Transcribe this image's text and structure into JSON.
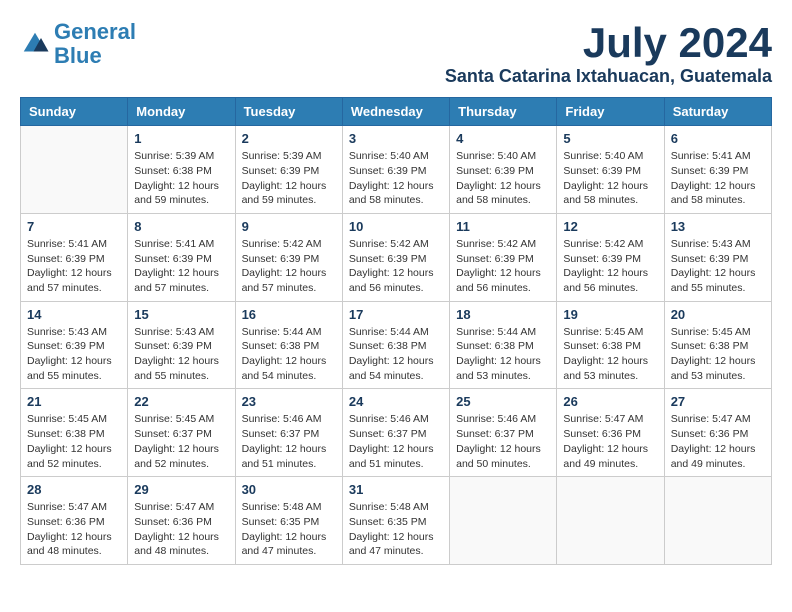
{
  "header": {
    "logo_line1": "General",
    "logo_line2": "Blue",
    "month_year": "July 2024",
    "location": "Santa Catarina Ixtahuacan, Guatemala"
  },
  "weekdays": [
    "Sunday",
    "Monday",
    "Tuesday",
    "Wednesday",
    "Thursday",
    "Friday",
    "Saturday"
  ],
  "weeks": [
    [
      {
        "day": "",
        "content": ""
      },
      {
        "day": "1",
        "content": "Sunrise: 5:39 AM\nSunset: 6:38 PM\nDaylight: 12 hours\nand 59 minutes."
      },
      {
        "day": "2",
        "content": "Sunrise: 5:39 AM\nSunset: 6:39 PM\nDaylight: 12 hours\nand 59 minutes."
      },
      {
        "day": "3",
        "content": "Sunrise: 5:40 AM\nSunset: 6:39 PM\nDaylight: 12 hours\nand 58 minutes."
      },
      {
        "day": "4",
        "content": "Sunrise: 5:40 AM\nSunset: 6:39 PM\nDaylight: 12 hours\nand 58 minutes."
      },
      {
        "day": "5",
        "content": "Sunrise: 5:40 AM\nSunset: 6:39 PM\nDaylight: 12 hours\nand 58 minutes."
      },
      {
        "day": "6",
        "content": "Sunrise: 5:41 AM\nSunset: 6:39 PM\nDaylight: 12 hours\nand 58 minutes."
      }
    ],
    [
      {
        "day": "7",
        "content": "Sunrise: 5:41 AM\nSunset: 6:39 PM\nDaylight: 12 hours\nand 57 minutes."
      },
      {
        "day": "8",
        "content": "Sunrise: 5:41 AM\nSunset: 6:39 PM\nDaylight: 12 hours\nand 57 minutes."
      },
      {
        "day": "9",
        "content": "Sunrise: 5:42 AM\nSunset: 6:39 PM\nDaylight: 12 hours\nand 57 minutes."
      },
      {
        "day": "10",
        "content": "Sunrise: 5:42 AM\nSunset: 6:39 PM\nDaylight: 12 hours\nand 56 minutes."
      },
      {
        "day": "11",
        "content": "Sunrise: 5:42 AM\nSunset: 6:39 PM\nDaylight: 12 hours\nand 56 minutes."
      },
      {
        "day": "12",
        "content": "Sunrise: 5:42 AM\nSunset: 6:39 PM\nDaylight: 12 hours\nand 56 minutes."
      },
      {
        "day": "13",
        "content": "Sunrise: 5:43 AM\nSunset: 6:39 PM\nDaylight: 12 hours\nand 55 minutes."
      }
    ],
    [
      {
        "day": "14",
        "content": "Sunrise: 5:43 AM\nSunset: 6:39 PM\nDaylight: 12 hours\nand 55 minutes."
      },
      {
        "day": "15",
        "content": "Sunrise: 5:43 AM\nSunset: 6:39 PM\nDaylight: 12 hours\nand 55 minutes."
      },
      {
        "day": "16",
        "content": "Sunrise: 5:44 AM\nSunset: 6:38 PM\nDaylight: 12 hours\nand 54 minutes."
      },
      {
        "day": "17",
        "content": "Sunrise: 5:44 AM\nSunset: 6:38 PM\nDaylight: 12 hours\nand 54 minutes."
      },
      {
        "day": "18",
        "content": "Sunrise: 5:44 AM\nSunset: 6:38 PM\nDaylight: 12 hours\nand 53 minutes."
      },
      {
        "day": "19",
        "content": "Sunrise: 5:45 AM\nSunset: 6:38 PM\nDaylight: 12 hours\nand 53 minutes."
      },
      {
        "day": "20",
        "content": "Sunrise: 5:45 AM\nSunset: 6:38 PM\nDaylight: 12 hours\nand 53 minutes."
      }
    ],
    [
      {
        "day": "21",
        "content": "Sunrise: 5:45 AM\nSunset: 6:38 PM\nDaylight: 12 hours\nand 52 minutes."
      },
      {
        "day": "22",
        "content": "Sunrise: 5:45 AM\nSunset: 6:37 PM\nDaylight: 12 hours\nand 52 minutes."
      },
      {
        "day": "23",
        "content": "Sunrise: 5:46 AM\nSunset: 6:37 PM\nDaylight: 12 hours\nand 51 minutes."
      },
      {
        "day": "24",
        "content": "Sunrise: 5:46 AM\nSunset: 6:37 PM\nDaylight: 12 hours\nand 51 minutes."
      },
      {
        "day": "25",
        "content": "Sunrise: 5:46 AM\nSunset: 6:37 PM\nDaylight: 12 hours\nand 50 minutes."
      },
      {
        "day": "26",
        "content": "Sunrise: 5:47 AM\nSunset: 6:36 PM\nDaylight: 12 hours\nand 49 minutes."
      },
      {
        "day": "27",
        "content": "Sunrise: 5:47 AM\nSunset: 6:36 PM\nDaylight: 12 hours\nand 49 minutes."
      }
    ],
    [
      {
        "day": "28",
        "content": "Sunrise: 5:47 AM\nSunset: 6:36 PM\nDaylight: 12 hours\nand 48 minutes."
      },
      {
        "day": "29",
        "content": "Sunrise: 5:47 AM\nSunset: 6:36 PM\nDaylight: 12 hours\nand 48 minutes."
      },
      {
        "day": "30",
        "content": "Sunrise: 5:48 AM\nSunset: 6:35 PM\nDaylight: 12 hours\nand 47 minutes."
      },
      {
        "day": "31",
        "content": "Sunrise: 5:48 AM\nSunset: 6:35 PM\nDaylight: 12 hours\nand 47 minutes."
      },
      {
        "day": "",
        "content": ""
      },
      {
        "day": "",
        "content": ""
      },
      {
        "day": "",
        "content": ""
      }
    ]
  ]
}
